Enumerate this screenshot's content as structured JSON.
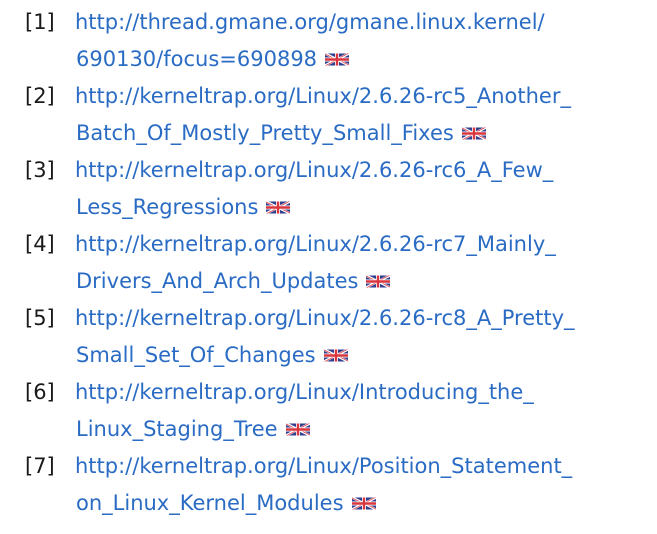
{
  "flag_icon": "uk-flag-icon",
  "references": [
    {
      "number": "[1]",
      "line1": "http://thread.gmane.org/gmane.linux.kernel/",
      "line2": "690130/focus=690898"
    },
    {
      "number": "[2]",
      "line1": "http://kerneltrap.org/Linux/2.6.26-rc5_Another_",
      "line2": "Batch_Of_Mostly_Pretty_Small_Fixes"
    },
    {
      "number": "[3]",
      "line1": "http://kerneltrap.org/Linux/2.6.26-rc6_A_Few_",
      "line2": "Less_Regressions"
    },
    {
      "number": "[4]",
      "line1": "http://kerneltrap.org/Linux/2.6.26-rc7_Mainly_",
      "line2": "Drivers_And_Arch_Updates"
    },
    {
      "number": "[5]",
      "line1": "http://kerneltrap.org/Linux/2.6.26-rc8_A_Pretty_",
      "line2": "Small_Set_Of_Changes"
    },
    {
      "number": "[6]",
      "line1": "http://kerneltrap.org/Linux/Introducing_the_",
      "line2": "Linux_Staging_Tree"
    },
    {
      "number": "[7]",
      "line1": "http://kerneltrap.org/Linux/Position_Statement_",
      "line2": "on_Linux_Kernel_Modules"
    }
  ]
}
